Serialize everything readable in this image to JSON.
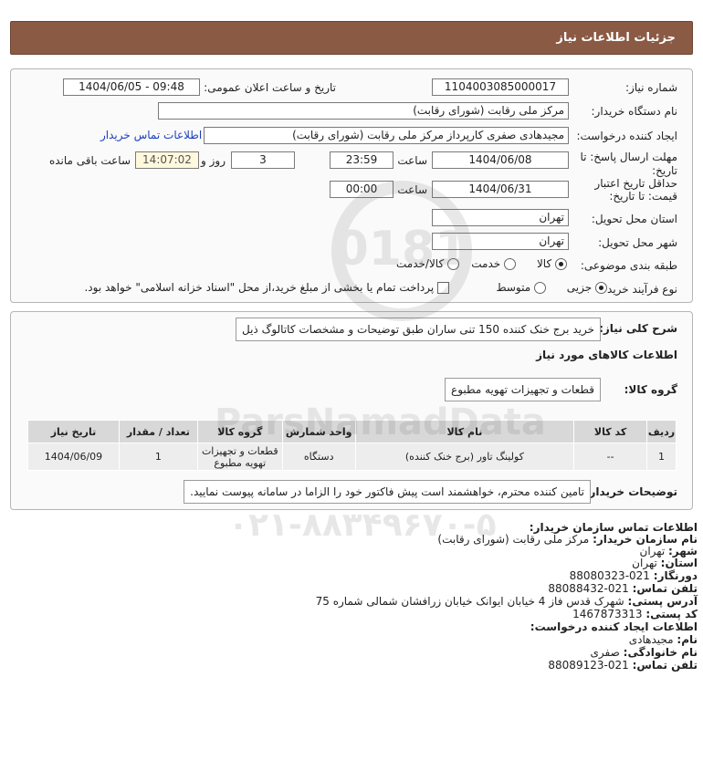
{
  "header": {
    "title": "جزئیات اطلاعات نیاز"
  },
  "form": {
    "need_number": {
      "label": "شماره نیاز:",
      "value": "1104003085000017"
    },
    "announce": {
      "label": "تاریخ و ساعت اعلان عمومی:",
      "value": "1404/06/05 - 09:48"
    },
    "buyer_org": {
      "label": "نام دستگاه خریدار:",
      "value": "مرکز ملی رقابت (شورای رقابت)"
    },
    "requester": {
      "label": "ایجاد کننده درخواست:",
      "value": "مجیدهادی صفری کارپرداز مرکز ملی رقابت (شورای رقابت)"
    },
    "contact_link": "اطلاعات تماس خریدار",
    "deadline": {
      "label_line1": "مهلت ارسال پاسخ: تا",
      "label_line2": "تاریخ:",
      "date": "1404/06/08",
      "time_label": "ساعت",
      "time": "23:59",
      "days": "3",
      "days_label": "روز و",
      "remaining": "14:07:02",
      "remaining_label": "ساعت باقی مانده"
    },
    "price_validity": {
      "label_line1": "حداقل تاریخ اعتبار",
      "label_line2": "قیمت: تا تاریخ:",
      "date": "1404/06/31",
      "time_label": "ساعت",
      "time": "00:00"
    },
    "province": {
      "label": "استان محل تحویل:",
      "value": "تهران"
    },
    "city": {
      "label": "شهر محل تحویل:",
      "value": "تهران"
    },
    "category": {
      "label": "طبقه بندی موضوعی:",
      "options": [
        "کالا",
        "خدمت",
        "کالا/خدمت"
      ],
      "selected": "کالا"
    },
    "process": {
      "label": "نوع فرآیند خرید :",
      "options": [
        "جزیی",
        "متوسط"
      ],
      "selected": "جزیی",
      "payment_note": "پرداخت تمام یا بخشی از مبلغ خرید،از محل \"اسناد خزانه اسلامی\" خواهد بود."
    }
  },
  "general": {
    "desc_label": "شرح کلی نیاز:",
    "desc_value": "خرید برج خنک کننده 150 تنی ساران طبق توضیحات و مشخصات کاتالوگ ذیل",
    "goods_heading": "اطلاعات کالاهای مورد نیاز",
    "group_label": "گروه کالا:",
    "group_value": "قطعات و تجهیزات تهویه مطبوع"
  },
  "table": {
    "headers": [
      "ردیف",
      "کد کالا",
      "نام کالا",
      "واحد شمارش",
      "گروه کالا",
      "تعداد / مقدار",
      "تاریخ نیاز"
    ],
    "rows": [
      [
        "1",
        "--",
        "کولینگ تاور (برج خنک کننده)",
        "دستگاه",
        "قطعات و تجهیزات تهویه مطبوع",
        "1",
        "1404/06/09"
      ]
    ]
  },
  "buyer_notes": {
    "label": "توضیحات خریدار:",
    "value": "تامین کننده محترم، خواهشمند است پیش فاکتور خود را الزاما در سامانه پیوست نمایید."
  },
  "contact": {
    "heading": "اطلاعات تماس سازمان خریدار:",
    "org_label": "نام سازمان خریدار:",
    "org_value": "مرکز ملی رقابت (شورای رقابت)",
    "city_label": "شهر:",
    "city_value": "تهران",
    "province_label": "استان:",
    "province_value": "تهران",
    "fax_label": "دورنگار:",
    "fax_value": "021-88080323",
    "phone_label": "تلفن تماس:",
    "phone_value": "021-88088432",
    "address_label": "آدرس پستی:",
    "address_value": "شهرک قدس فاز 4 خیابان ایوانک خیابان زرافشان شمالی شماره 75",
    "postal_label": "کد پستی:",
    "postal_value": "1467873313",
    "creator_heading": "اطلاعات ایجاد کننده درخواست:",
    "name_label": "نام:",
    "name_value": "مجیدهادی",
    "family_label": "نام خانوادگی:",
    "family_value": "صفری",
    "creator_phone_label": "تلفن تماس:",
    "creator_phone_value": "021-88089123"
  },
  "watermark": {
    "brand": "ParsNamadData",
    "phone": "۰۲۱-۸۸۳۴۹۶۷۰-۵"
  },
  "colors": {
    "header_bg": "#8b5a44",
    "link": "#1a3fbf",
    "remain_bg": "#fff8dc"
  }
}
